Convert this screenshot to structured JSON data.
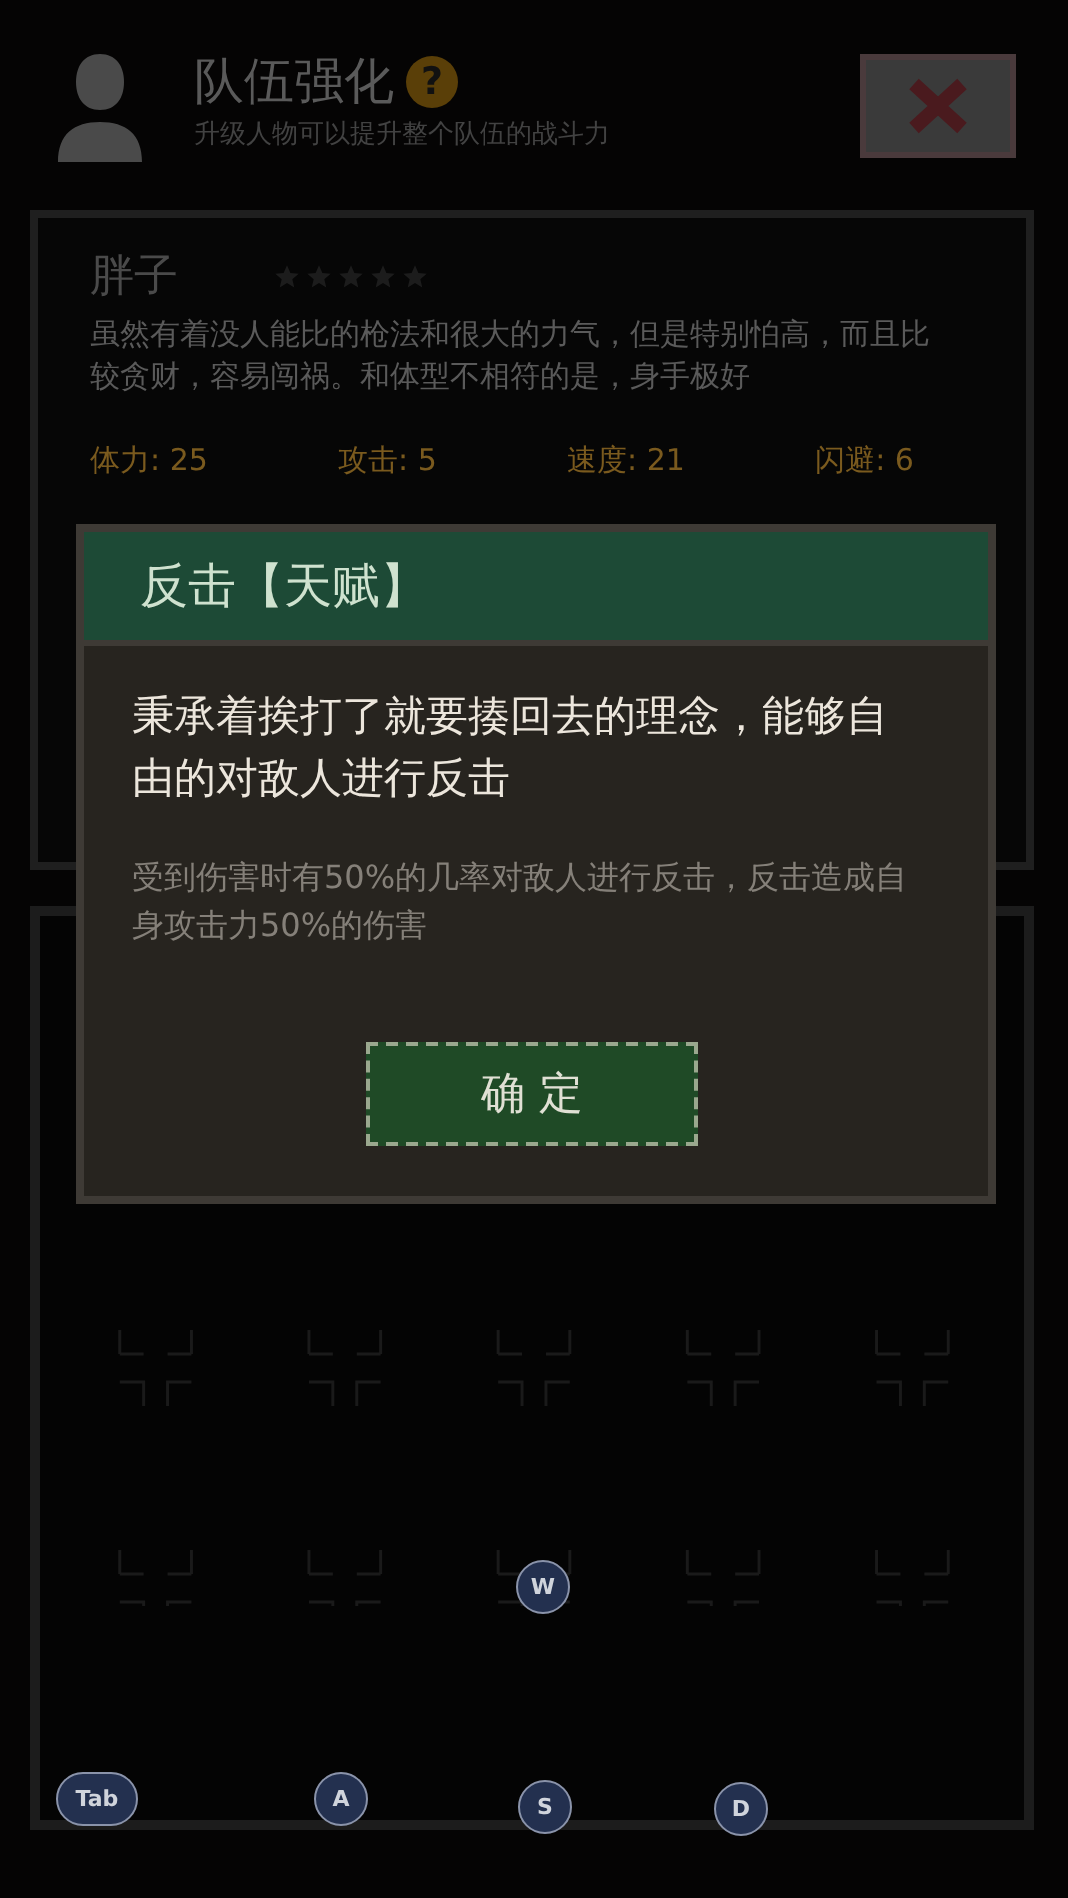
{
  "header": {
    "title": "队伍强化",
    "help": "?",
    "subtitle": "升级人物可以提升整个队伍的战斗力"
  },
  "character": {
    "name": "胖子",
    "stars": 0,
    "description": "虽然有着没人能比的枪法和很大的力气，但是特别怕高，而且比较贪财，容易闯祸。和体型不相符的是，身手极好",
    "stats": [
      "体力: 25",
      "攻击: 5",
      "速度: 21",
      "闪避: 6"
    ]
  },
  "dialog": {
    "title": "反击【天赋】",
    "text": "秉承着挨打了就要揍回去的理念，能够自由的对敌人进行反击",
    "detail": "受到伤害时有50%的几率对敌人进行反击，反击造成自身攻击力50%的伤害",
    "button": "确 定"
  },
  "keys": [
    {
      "label": "W",
      "kind": "round"
    },
    {
      "label": "Tab",
      "kind": "pill"
    },
    {
      "label": "A",
      "kind": "round"
    },
    {
      "label": "S",
      "kind": "round"
    },
    {
      "label": "D",
      "kind": "round"
    }
  ]
}
